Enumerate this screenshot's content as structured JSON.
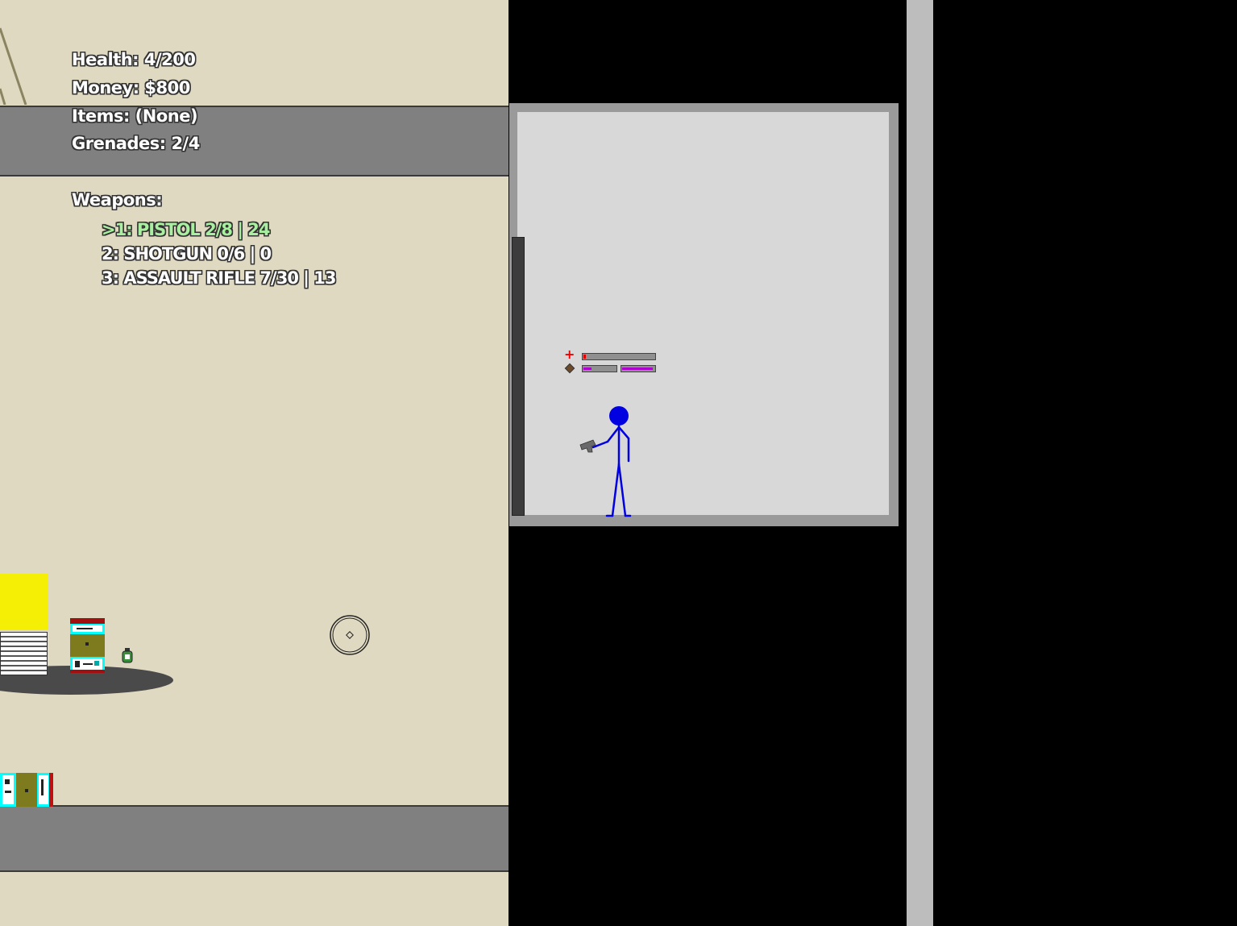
{
  "hud": {
    "health": "Health: 4/200",
    "money": "Money: $800",
    "items": "Items: (None)",
    "grenades": "Grenades: 2/4",
    "weapons_header": "Weapons:",
    "weapons": [
      {
        "label": ">1: PISTOL 2/8 | 24",
        "active": true
      },
      {
        "label": "2: SHOTGUN 0/6 | 0",
        "active": false
      },
      {
        "label": "3: ASSAULT RIFLE 7/30 | 13",
        "active": false
      }
    ]
  },
  "player": {
    "color": "#0000e0",
    "health_fraction": 0.02,
    "clip_fraction": 0.25,
    "reserve_fraction": 0.95,
    "held_item": "pistol-icon"
  },
  "colors": {
    "wall": "#dfd9c1",
    "band": "#808080",
    "elevator": "#d8d8d8",
    "health": "#e00000",
    "ammo": "#b000d0",
    "highlight": "#a8f0a0"
  }
}
